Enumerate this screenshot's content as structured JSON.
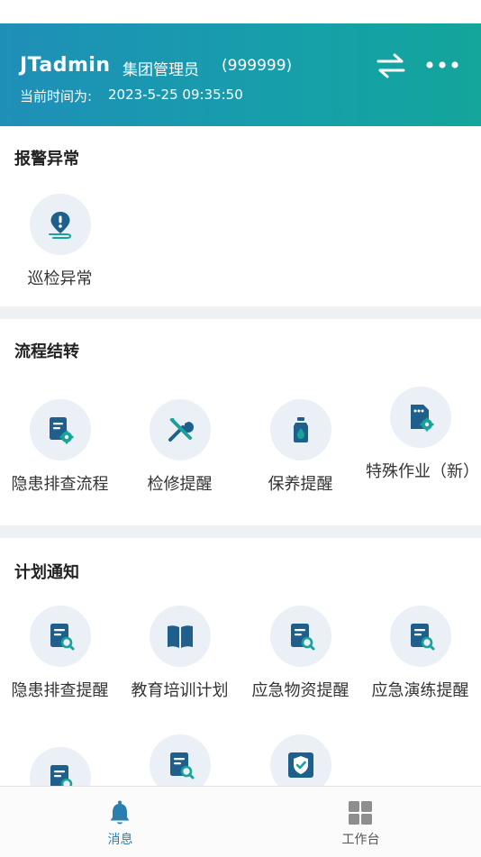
{
  "header": {
    "username": "JTadmin",
    "role": "集团管理员",
    "code": "(999999)",
    "time_label": "当前时间为:",
    "time_value": "2023-5-25 09:35:50"
  },
  "sections": {
    "alarm": {
      "title": "报警异常",
      "items": [
        {
          "label": "巡检异常",
          "icon": "location-alert-icon"
        }
      ]
    },
    "flow": {
      "title": "流程结转",
      "items": [
        {
          "label": "隐患排查流程",
          "icon": "doc-gear-icon"
        },
        {
          "label": "检修提醒",
          "icon": "tools-icon"
        },
        {
          "label": "保养提醒",
          "icon": "bottle-drop-icon"
        },
        {
          "label": "特殊作业（新）",
          "icon": "file-gear-icon"
        }
      ]
    },
    "plan": {
      "title": "计划通知",
      "items": [
        {
          "label": "隐患排查提醒",
          "icon": "doc-search-icon"
        },
        {
          "label": "教育培训计划",
          "icon": "book-icon"
        },
        {
          "label": "应急物资提醒",
          "icon": "doc-search-icon"
        },
        {
          "label": "应急演练提醒",
          "icon": "doc-search-icon"
        },
        {
          "label": "",
          "icon": "doc-search-icon"
        },
        {
          "label": "",
          "icon": "doc-search-icon"
        },
        {
          "label": "",
          "icon": "shield-check-icon"
        }
      ]
    }
  },
  "tabbar": {
    "messages": {
      "label": "消息",
      "icon": "bell-icon"
    },
    "workbench": {
      "label": "工作台",
      "icon": "grid-icon"
    }
  },
  "colors": {
    "accent": "#2a7fb0",
    "header_start": "#1f8fb8",
    "header_end": "#14a59b",
    "icon_bg": "#eaf0f5",
    "teal": "#17a39a"
  }
}
